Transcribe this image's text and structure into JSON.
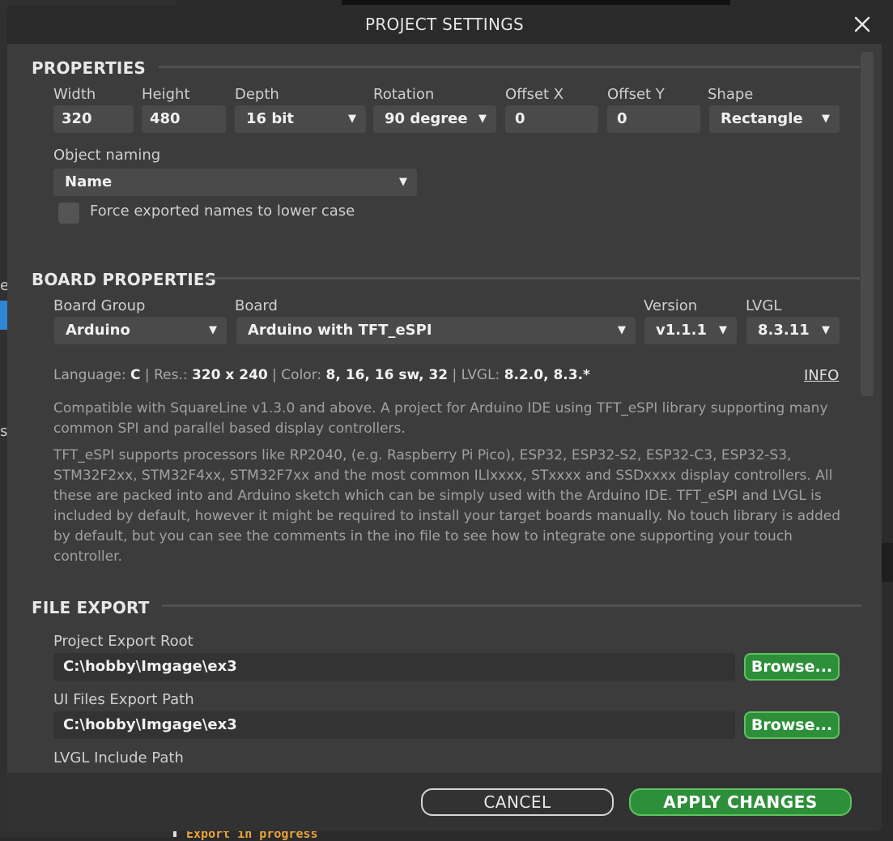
{
  "background": {
    "left_fragments": [
      "e",
      "s"
    ],
    "bottom_text": "Export in progress"
  },
  "dialog": {
    "title": "PROJECT SETTINGS"
  },
  "properties": {
    "section_title": "PROPERTIES",
    "width": {
      "label": "Width",
      "value": "320"
    },
    "height": {
      "label": "Height",
      "value": "480"
    },
    "depth": {
      "label": "Depth",
      "value": "16 bit"
    },
    "rotation": {
      "label": "Rotation",
      "value": "90 degree"
    },
    "offset_x": {
      "label": "Offset X",
      "value": "0"
    },
    "offset_y": {
      "label": "Offset Y",
      "value": "0"
    },
    "shape": {
      "label": "Shape",
      "value": "Rectangle"
    },
    "object_naming": {
      "label": "Object naming",
      "value": "Name"
    },
    "lowercase_checkbox": {
      "label": "Force exported names to lower case",
      "checked": false
    }
  },
  "board_properties": {
    "section_title": "BOARD PROPERTIES",
    "board_group": {
      "label": "Board Group",
      "value": "Arduino"
    },
    "board": {
      "label": "Board",
      "value": "Arduino with TFT_eSPI"
    },
    "version": {
      "label": "Version",
      "value": "v1.1.1"
    },
    "lvgl": {
      "label": "LVGL",
      "value": "8.3.11"
    },
    "info": {
      "language_label": "Language:",
      "language": "C",
      "sep": "|",
      "res_label": "Res.:",
      "res": "320 x 240",
      "color_label": "Color:",
      "color": "8, 16, 16 sw, 32",
      "lvgl_label": "LVGL:",
      "lvgl": "8.2.0, 8.3.*",
      "link": "INFO"
    },
    "description_1": "Compatible with SquareLine v1.3.0 and above. A project for Arduino IDE using TFT_eSPI library supporting many common SPI and parallel based display controllers.",
    "description_2": "TFT_eSPI supports processors like RP2040, (e.g. Raspberry Pi Pico), ESP32, ESP32-S2, ESP32-C3, ESP32-S3, STM32F2xx, STM32F4xx, STM32F7xx and the most common ILIxxxx, STxxxx and SSDxxxx display controllers. All these are packed into and Arduino sketch which can be simply used with the Arduino IDE. TFT_eSPI and LVGL is included by default, however it might be required to install your target boards manually.  No touch library is added by default, but you can see the comments in the ino file to see how to integrate one supporting your touch controller."
  },
  "file_export": {
    "section_title": "FILE EXPORT",
    "project_root": {
      "label": "Project Export Root",
      "value": "C:\\hobby\\Imgage\\ex3",
      "button": "Browse..."
    },
    "ui_files": {
      "label": "UI Files Export Path",
      "value": "C:\\hobby\\Imgage\\ex3",
      "button": "Browse..."
    },
    "lvgl_include": {
      "label": "LVGL Include Path"
    }
  },
  "footer": {
    "cancel": "CANCEL",
    "apply": "APPLY CHANGES"
  },
  "colors": {
    "accent_green": "#2e8f3a",
    "accent_green_border": "#5fc25f",
    "panel": "#3c3c3c",
    "titlebar": "#2a2a2a"
  }
}
